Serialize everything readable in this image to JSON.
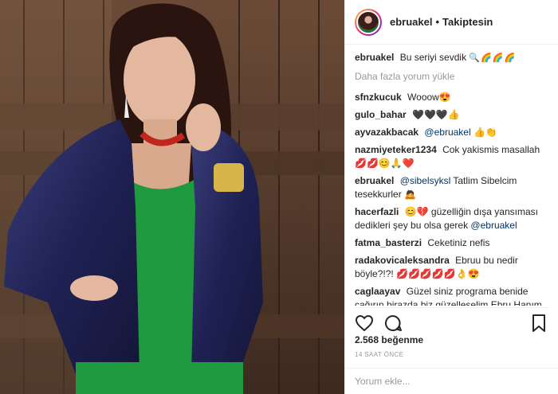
{
  "post": {
    "username": "ebruakel",
    "dot": "•",
    "follow_status": "Takiptesin"
  },
  "caption": {
    "user": "ebruakel",
    "text": "Bu seriyi sevdik",
    "emojis": "🔍🌈🌈🌈"
  },
  "load_more": "Daha fazla yorum yükle",
  "comments": [
    {
      "user": "sfnzkucuk",
      "text": "Wooow😍"
    },
    {
      "user": "gulo_bahar",
      "text": "🖤🖤🖤👍"
    },
    {
      "user": "ayvazakbacak",
      "mention": "@ebruakel",
      "text": "👍👏"
    },
    {
      "user": "nazmiyeteker1234",
      "text": "Cok yakismis masallah 💋💋😊🙏❤️"
    },
    {
      "user": "ebruakel",
      "mention": "@sibelsyksl",
      "text": "Tatlim Sibelcim tesekkurler 🙇"
    },
    {
      "user": "hacerfazli",
      "text": "😊💔 güzelliğin dışa yansıması dedikleri şey bu olsa gerek",
      "mention_after": "@ebruakel"
    },
    {
      "user": "fatma_basterzi",
      "text": "Ceketiniz nefis"
    },
    {
      "user": "radakovicaleksandra",
      "text": "Ebruu bu nedir böyle?!?! 💋💋💋💋💋👌😍"
    },
    {
      "user": "caglaayav",
      "text": "Güzel siniz programa benide çağırın birazda biz güzelleşelim Ebru Hanım 😂"
    }
  ],
  "likes": "2.568 beğenme",
  "time_ago": "14 saat önce",
  "add_comment_placeholder": "Yorum ekle...",
  "icons": {
    "like": "heart-icon",
    "comment": "comment-icon",
    "save": "bookmark-icon"
  },
  "colors": {
    "text": "#262626",
    "muted": "#999999",
    "mention": "#003569",
    "border": "#efefef"
  }
}
